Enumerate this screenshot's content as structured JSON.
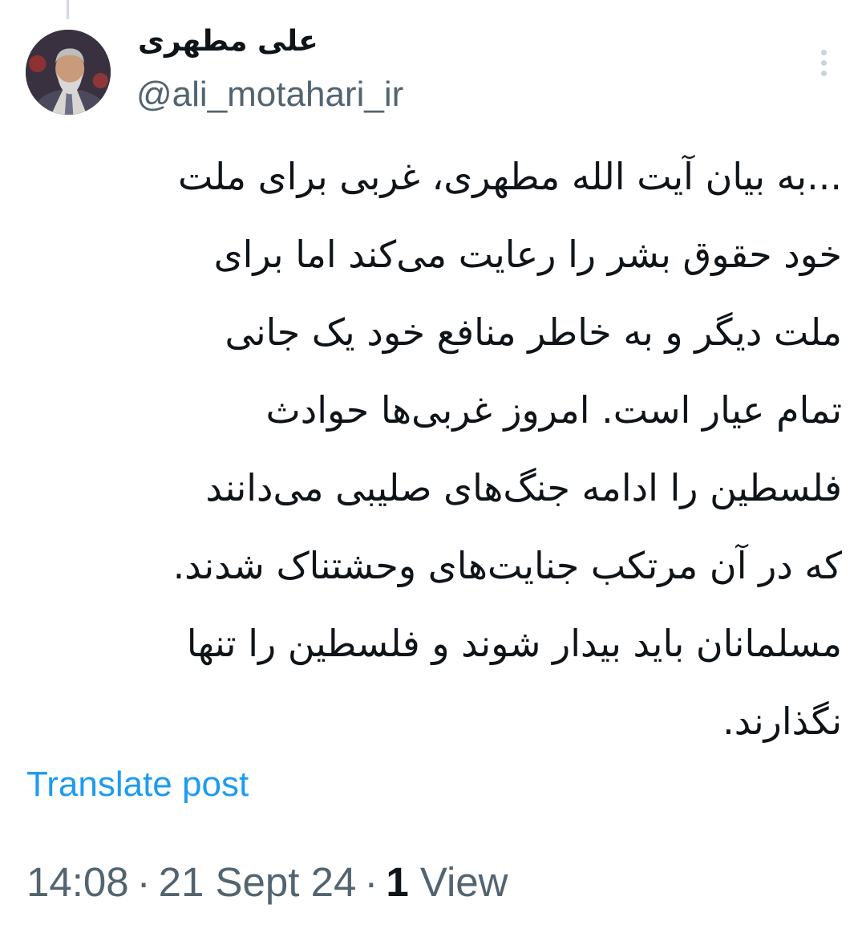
{
  "author": {
    "display_name": "علی مطهری",
    "handle": "@ali_motahari_ir"
  },
  "tweet": {
    "lines": [
      "...به بیان آیت الله مطهری، غربی برای ملت",
      "خود حقوق بشر را رعایت می‌کند اما برای",
      "ملت دیگر و به خاطر منافع خود یک جانی",
      "تمام عیار است. امروز غربی‌ها حوادث",
      "فلسطین را ادامه جنگ‌های صلیبی می‌دانند",
      "که در آن مرتکب جنایت‌های وحشتناک شدند.",
      "مسلمانان باید بیدار شوند و فلسطین را تنها",
      "نگذارند."
    ]
  },
  "translate_label": "Translate post",
  "meta": {
    "time": "14:08",
    "separator": "·",
    "date": "21 Sept 24",
    "view_count": "1",
    "view_label": "View"
  },
  "icons": {
    "more": "more-vertical-icon",
    "avatar": "profile-photo"
  },
  "colors": {
    "link": "#1d9bf0",
    "secondary_text": "#536471",
    "primary_text": "#0f1419"
  }
}
